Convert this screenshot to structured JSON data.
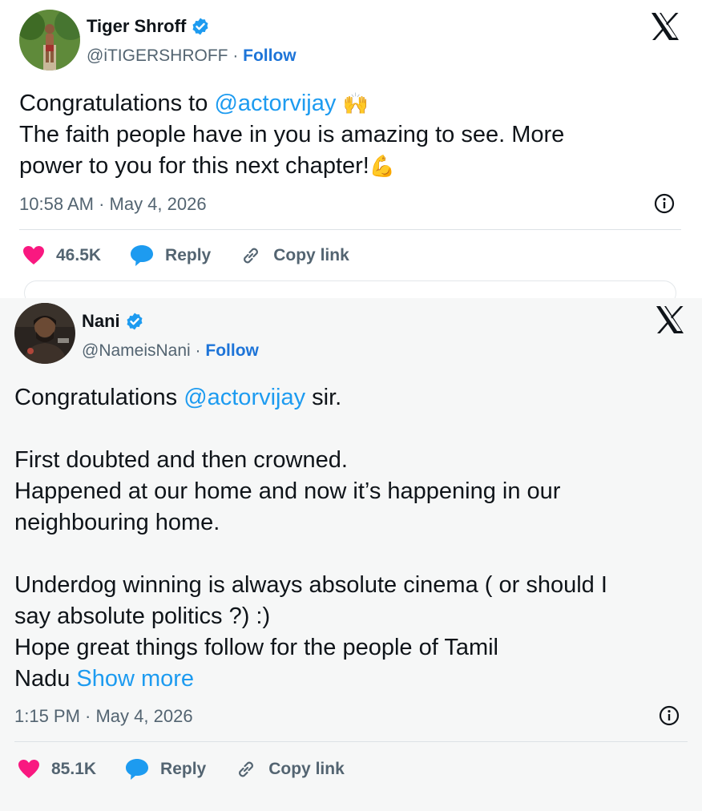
{
  "tweets": [
    {
      "author": {
        "name": "Tiger Shroff",
        "handle": "@iTIGERSHROFF",
        "separator": " · ",
        "follow_label": "Follow"
      },
      "text": {
        "l1_prefix": "Congratulations to ",
        "l1_mention": "@actorvijay",
        "l1_emoji": "🙌",
        "l2": "The faith people have in you is amazing to see. More",
        "l3": "power to you for this next chapter!",
        "l3_emoji": "💪"
      },
      "timestamp": "10:58 AM · May 4, 2026",
      "actions": {
        "likes": "46.5K",
        "reply": "Reply",
        "copy": "Copy link"
      }
    },
    {
      "author": {
        "name": "Nani",
        "handle": "@NameisNani",
        "separator": " · ",
        "follow_label": "Follow"
      },
      "text": {
        "l1_prefix": "Congratulations ",
        "l1_mention": "@actorvijay",
        "l1_suffix": " sir.",
        "p2_l1": "First doubted and then crowned.",
        "p2_l2": "Happened at our home and now it’s happening in our",
        "p2_l3": "neighbouring home.",
        "p3_l1": "Underdog winning is always absolute cinema ( or should I",
        "p3_l2": "say absolute politics ?) :)",
        "p3_l3": "Hope great things follow for the people of Tamil",
        "p3_l4": "Nadu ",
        "show_more": "Show more"
      },
      "timestamp": "1:15 PM · May 4, 2026",
      "actions": {
        "likes": "85.1K",
        "reply": "Reply",
        "copy": "Copy link"
      }
    }
  ],
  "icons": {
    "verified": "verified-badge-icon",
    "x_logo": "x-logo-icon",
    "info": "info-icon",
    "heart": "heart-icon",
    "reply": "reply-bubble-icon",
    "link": "link-icon"
  },
  "colors": {
    "mention": "#1d9bf0",
    "follow": "#1d74d8",
    "heart": "#f91880",
    "reply": "#1d9bf0",
    "muted": "#536471"
  }
}
